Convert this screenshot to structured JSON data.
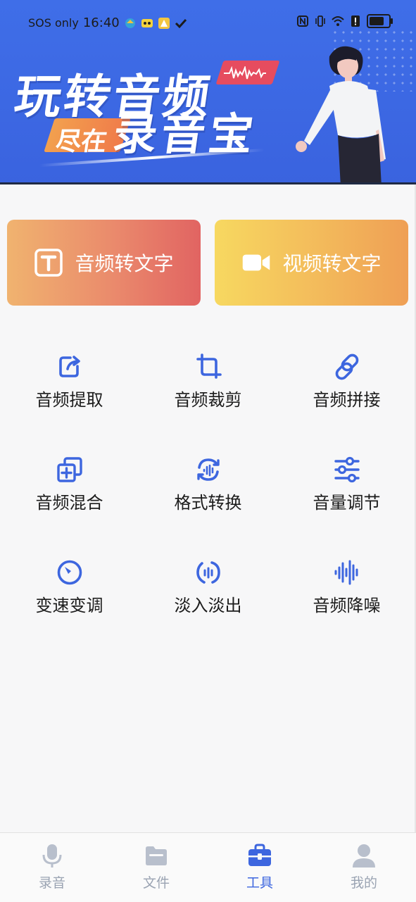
{
  "status_bar": {
    "carrier": "SOS only",
    "time": "16:40"
  },
  "banner": {
    "headline_line1": "玩转音频",
    "headline_prefix": "尽在",
    "headline_app": "录音宝"
  },
  "big_cards": [
    {
      "label": "音频转文字",
      "icon": "text-t-icon"
    },
    {
      "label": "视频转文字",
      "icon": "video-camera-icon"
    }
  ],
  "tools": [
    {
      "label": "音频提取",
      "icon": "extract-icon"
    },
    {
      "label": "音频裁剪",
      "icon": "crop-icon"
    },
    {
      "label": "音频拼接",
      "icon": "link-icon"
    },
    {
      "label": "音频混合",
      "icon": "mix-layers-icon"
    },
    {
      "label": "格式转换",
      "icon": "convert-icon"
    },
    {
      "label": "音量调节",
      "icon": "sliders-icon"
    },
    {
      "label": "变速变调",
      "icon": "speed-dial-icon"
    },
    {
      "label": "淡入淡出",
      "icon": "fade-icon"
    },
    {
      "label": "音频降噪",
      "icon": "noise-reduce-icon"
    }
  ],
  "tabbar": {
    "tabs": [
      {
        "label": "录音",
        "icon": "microphone-icon",
        "active": false
      },
      {
        "label": "文件",
        "icon": "folder-icon",
        "active": false
      },
      {
        "label": "工具",
        "icon": "toolbox-icon",
        "active": true
      },
      {
        "label": "我的",
        "icon": "person-icon",
        "active": false
      }
    ]
  },
  "colors": {
    "accent": "#3d66df",
    "banner_bg": "#3f6ee8",
    "tab_inactive": "#9aa3b2"
  }
}
